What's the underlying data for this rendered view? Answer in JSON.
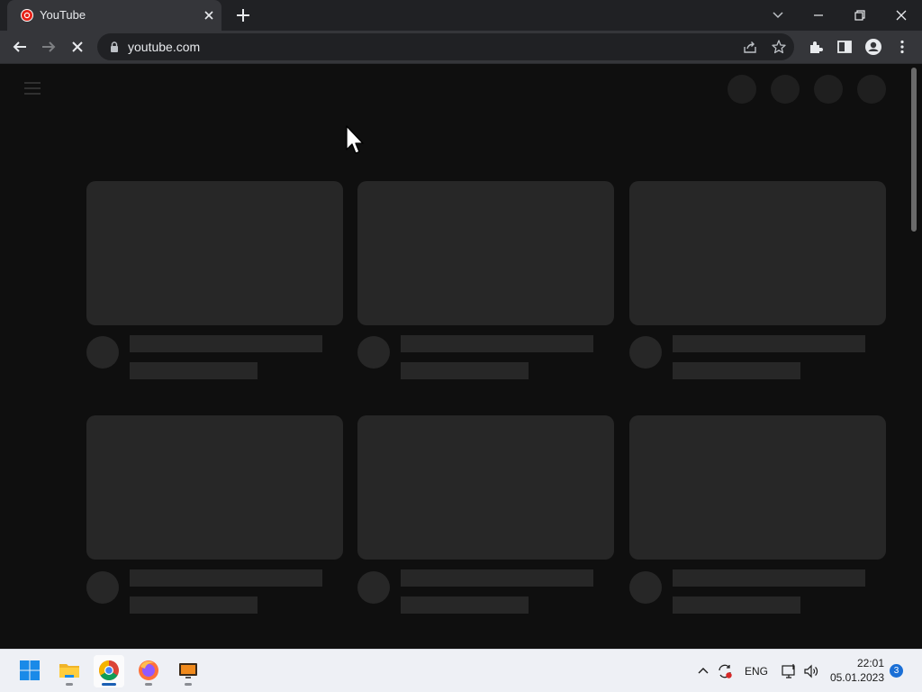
{
  "browser": {
    "tab": {
      "title": "YouTube",
      "favicon": "youtube-icon",
      "close_icon": "close-icon"
    },
    "new_tab_icon": "plus-icon",
    "tab_search_icon": "chevron-down-icon",
    "window_controls": [
      "minimize-icon",
      "restore-icon",
      "close-icon"
    ],
    "toolbar": {
      "nav_icons": [
        "back-arrow-icon",
        "forward-arrow-icon",
        "stop-loading-icon"
      ],
      "url": "youtube.com",
      "omnibox_icons": [
        "lock-icon",
        "share-icon",
        "star-icon"
      ],
      "action_icons": [
        "extensions-icon",
        "side-panel-icon",
        "profile-icon",
        "more-vert-icon"
      ]
    }
  },
  "page": {
    "state": "loading",
    "header_icons": [
      "menu-icon"
    ],
    "header_placeholder_count": 4,
    "video_placeholder_count": 6
  },
  "taskbar": {
    "apps": [
      "windows-start-icon",
      "file-explorer-icon",
      "chrome-icon",
      "firefox-icon",
      "app-icon"
    ],
    "active_app": "chrome-icon",
    "tray_icons": [
      "chevron-up-icon",
      "sync-icon",
      "network-icon",
      "volume-icon"
    ],
    "language": "ENG",
    "time": "22:01",
    "date": "05.01.2023",
    "notification_count": "3"
  },
  "colors": {
    "page_background": "#0f0f0f",
    "placeholder": "#272727",
    "chrome_frame": "#202124",
    "toolbar": "#35363a",
    "taskbar": "#eef0f5",
    "accent": "#1a6fd6"
  }
}
